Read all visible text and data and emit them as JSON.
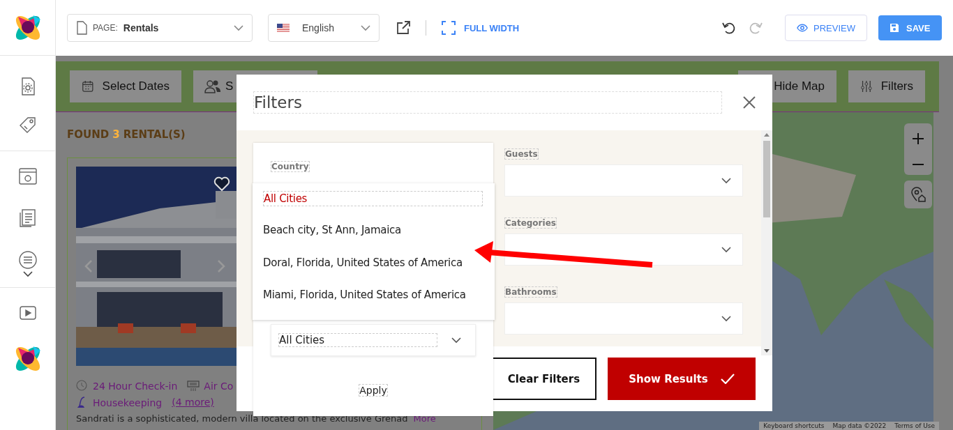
{
  "top_bar": {
    "page_label": "PAGE:",
    "page_value": "Rentals",
    "language": "English",
    "full_width": "FULL WIDTH",
    "preview": "PREVIEW",
    "save": "SAVE"
  },
  "toolbar": [
    {
      "label": "Select Dates",
      "kind": "dates"
    },
    {
      "label": "S",
      "kind": "guests"
    },
    {
      "label": "Hide Map",
      "kind": "map"
    },
    {
      "label": "Filters",
      "kind": "filters"
    }
  ],
  "results": {
    "prefix": "FOUND",
    "count": "3",
    "suffix": "RENTAL(S)"
  },
  "listing": {
    "amenities": [
      {
        "label": "24 Hour Check-in",
        "kind": "clock"
      },
      {
        "label": "Air Co",
        "kind": "aircon"
      },
      {
        "label": "Housekeeping",
        "kind": "vacuum"
      }
    ],
    "more_amenities": "(4 more)",
    "description": "Sandrati is a sophisticated, modern villa located on the exclusive Grenad",
    "more": "More"
  },
  "map": {
    "attribution": [
      "Keyboard shortcuts",
      "Map data ©2022",
      "Terms of Use"
    ]
  },
  "modal": {
    "title": "Filters",
    "fields": [
      {
        "label": "Guests"
      },
      {
        "label": "Categories"
      },
      {
        "label": "Bathrooms"
      }
    ],
    "clear": "Clear Filters",
    "show": "Show Results"
  },
  "city_panel": {
    "country_label": "Country",
    "options": [
      {
        "label": "All Cities",
        "selected": true
      },
      {
        "label": "Beach city, St Ann, Jamaica",
        "selected": false
      },
      {
        "label": "Doral, Florida, United States of America",
        "selected": false
      },
      {
        "label": "Miami, Florida, United States of America",
        "selected": false
      }
    ],
    "city_value": "All Cities",
    "apply": "Apply"
  }
}
